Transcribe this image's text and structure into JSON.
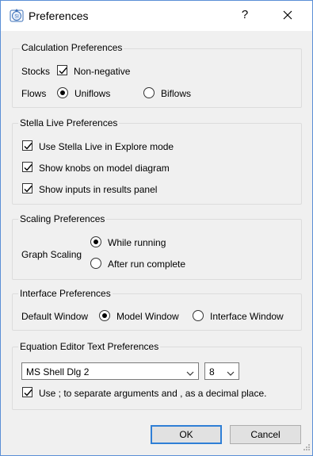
{
  "window": {
    "title": "Preferences",
    "help_label": "?",
    "app_icon_text": "Sl"
  },
  "calc": {
    "title": "Calculation Preferences",
    "stocks_label": "Stocks",
    "nonneg_label": "Non-negative",
    "nonneg_checked": true,
    "flows_label": "Flows",
    "uniflows_label": "Uniflows",
    "biflows_label": "Biflows",
    "selected_flow": "Uniflows"
  },
  "stella": {
    "title": "Stella Live Preferences",
    "items": [
      {
        "label": "Use Stella Live in Explore mode",
        "checked": true
      },
      {
        "label": "Show knobs on model diagram",
        "checked": true
      },
      {
        "label": "Show inputs in results panel",
        "checked": true
      }
    ]
  },
  "scaling": {
    "title": "Scaling Preferences",
    "graph_scaling_label": "Graph Scaling",
    "while_running_label": "While running",
    "after_run_label": "After run complete",
    "selected": "While running"
  },
  "iface": {
    "title": "Interface Preferences",
    "default_window_label": "Default Window",
    "model_window_label": "Model Window",
    "interface_window_label": "Interface Window",
    "selected": "Model Window"
  },
  "eq": {
    "title": "Equation Editor Text Preferences",
    "font_value": "MS Shell Dlg 2",
    "size_value": "8",
    "separator_label": "Use ; to separate arguments and , as a decimal place.",
    "separator_checked": true
  },
  "footer": {
    "ok_label": "OK",
    "cancel_label": "Cancel"
  },
  "colors": {
    "accent": "#2f7fd6",
    "window_border": "#5b8fd6",
    "background": "#f0f0f0"
  }
}
